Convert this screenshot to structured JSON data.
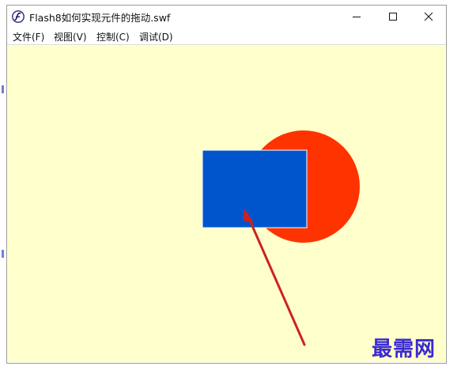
{
  "window": {
    "title": "Flash8如何实现元件的拖动.swf"
  },
  "menu": {
    "items": [
      {
        "label": "文件(F)"
      },
      {
        "label": "视图(V)"
      },
      {
        "label": "控制(C)"
      },
      {
        "label": "调试(D)"
      }
    ]
  },
  "stage": {
    "background": "#ffffcc",
    "circle_color": "#ff3300",
    "rectangle_color": "#0055cc",
    "arrow_color": "#cc2222"
  },
  "watermark": {
    "text": "最需网"
  },
  "icons": {
    "app": "flash-player-icon",
    "minimize": "minimize-icon",
    "maximize": "maximize-icon",
    "close": "close-icon"
  }
}
